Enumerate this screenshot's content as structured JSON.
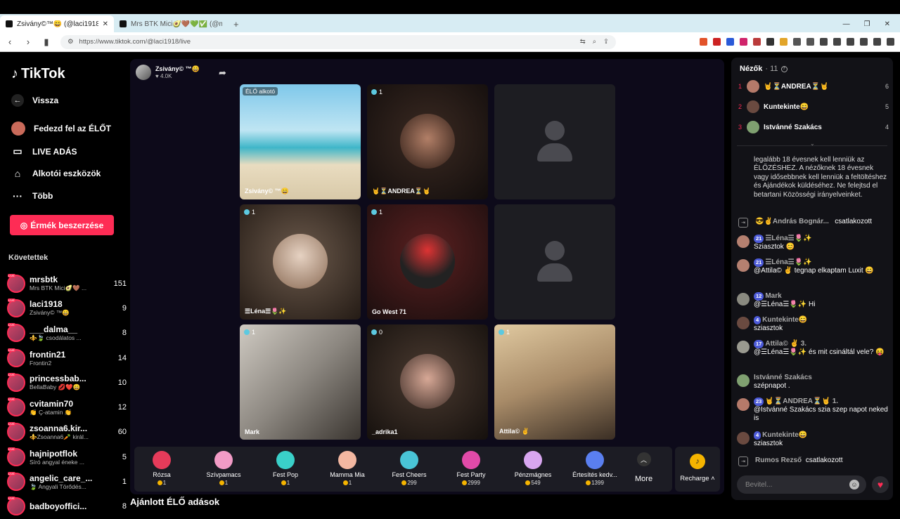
{
  "browser": {
    "tabs": [
      {
        "title": "Zsivány©™😄 (@laci1918) É...",
        "active": true
      },
      {
        "title": "Mrs BTK Mici🥑🤎💚✅ (@mrsbtk) É...",
        "active": false
      }
    ],
    "new_tab": "+",
    "url": "https://www.tiktok.com/@laci1918/live"
  },
  "sidebar": {
    "logo": "TikTok",
    "back": "Vissza",
    "explore": "Fedezd fel az ÉLŐT",
    "live": "LIVE ADÁS",
    "creator": "Alkotói eszközök",
    "more": "Több",
    "buy_coins": "Érmék beszerzése",
    "following_title": "Követettek",
    "following": [
      {
        "name": "mrsbtk",
        "sub": "Mrs BTK Mici🥑🤎 ...",
        "count": "151"
      },
      {
        "name": "laci1918",
        "sub": "Zsivány© ™😄",
        "count": "9"
      },
      {
        "name": "___dalma__",
        "sub": "⚜️🍃 csodálatos ...",
        "count": "8"
      },
      {
        "name": "frontin21",
        "sub": "Frontin2",
        "count": "14"
      },
      {
        "name": "princessbab...",
        "sub": "BellaBaby 💋❤️😄",
        "count": "10"
      },
      {
        "name": "cvitamin70",
        "sub": "👏 Ç-atamin 👏",
        "count": "12"
      },
      {
        "name": "zsoanna6.kir...",
        "sub": "⚜️Zsoanna6🥕 királ...",
        "count": "60"
      },
      {
        "name": "hajnipotflok",
        "sub": "Síró angyal éneke ...",
        "count": "5"
      },
      {
        "name": "angelic_care_...",
        "sub": "🍃 Angyali Törődés...",
        "count": "1"
      },
      {
        "name": "badboyoffici...",
        "sub": "",
        "count": "8"
      }
    ]
  },
  "stream": {
    "host_name": "Zsivány© ™😄",
    "host_likes": "♥ 4.0K",
    "tiles": [
      {
        "label": "Zsivány© ™😄",
        "count": "",
        "tag": "ÉLŐ alkotó"
      },
      {
        "label": "🤘⏳ANDREA⏳🤘",
        "count": "1"
      },
      {
        "label": "",
        "count": ""
      },
      {
        "label": "☰Léna☰🌷✨",
        "count": "1"
      },
      {
        "label": "Go West 71",
        "count": "1"
      },
      {
        "label": "",
        "count": ""
      },
      {
        "label": "Mark",
        "count": "1"
      },
      {
        "label": "_adrika1",
        "count": "0"
      },
      {
        "label": "Attila© ✌️",
        "count": "1"
      }
    ]
  },
  "gifts": [
    {
      "name": "Rózsa",
      "price": "1",
      "color": "#e63b5a"
    },
    {
      "name": "Szívpamacs",
      "price": "1",
      "color": "#f29bc6"
    },
    {
      "name": "Fest Pop",
      "price": "1",
      "color": "#3ad0c9"
    },
    {
      "name": "Mamma Mia",
      "price": "1",
      "color": "#f3b7a1"
    },
    {
      "name": "Fest Cheers",
      "price": "299",
      "color": "#49c4d6"
    },
    {
      "name": "Fest Party",
      "price": "2999",
      "color": "#e14aa8"
    },
    {
      "name": "Pénzmágnes",
      "price": "549",
      "color": "#d8a6f0"
    },
    {
      "name": "Értesítés kedv...",
      "price": "1399",
      "color": "#5a7ff0"
    }
  ],
  "gift_more": "More",
  "recharge": "Recharge",
  "recommended": "Ajánlott ÉLŐ adások",
  "chat": {
    "viewers_label": "Nézők",
    "viewers_count": "· 11",
    "top": [
      {
        "pos": "1",
        "name": "🤘⏳ANDREA⏳🤘",
        "score": "6"
      },
      {
        "pos": "2",
        "name": "Kuntekinte😄",
        "score": "5"
      },
      {
        "pos": "3",
        "name": "Istvánné Szakács",
        "score": "4"
      }
    ],
    "notice": "legalább 18 évesnek kell lenniük az ÉLŐZÉSHEZ. A nézőknek 18 évesnek vagy idősebbnek kell lenniük a feltöltéshez és Ajándékok küldéséhez. Ne felejtsd el betartani Közösségi irányelveinket.",
    "messages": [
      {
        "type": "join",
        "user": "😎✌️András Bognár...",
        "text": "csatlakozott"
      },
      {
        "badge": "21",
        "user": "☰Léna☰🌷✨",
        "text": "Sziasztok 😊"
      },
      {
        "badge": "21",
        "user": "☰Léna☰🌷✨",
        "text": "@Attila© ✌️ tegnap elkaptam Luxit 😄"
      },
      {
        "badge": "12",
        "user": "Mark",
        "text": "@☰Léna☰🌷✨ Hi"
      },
      {
        "badge": "4",
        "user": "Kuntekinte😄",
        "text": "sziasztok"
      },
      {
        "badge": "17",
        "user": "Attila© ✌️ 3.",
        "text": "@☰Léna☰🌷✨ és mit csináltál vele? 😝"
      },
      {
        "badge": "",
        "user": "Istvánné Szakács",
        "text": "szépnapot ."
      },
      {
        "badge": "23",
        "user": "🤘⏳ANDREA⏳🤘 1.",
        "text": "@Istvánné Szakács szia szep napot neked is"
      },
      {
        "badge": "4",
        "user": "Kuntekinte😄",
        "text": "sziasztok"
      },
      {
        "type": "join",
        "user": "Rumos Rezső",
        "text": "csatlakozott"
      }
    ],
    "input_placeholder": "Bevitel..."
  }
}
